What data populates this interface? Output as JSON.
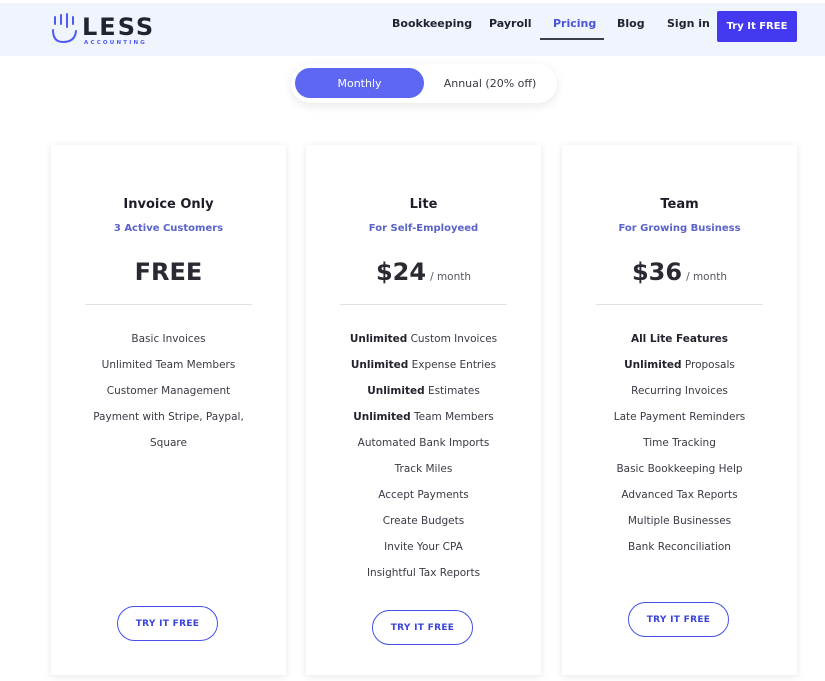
{
  "brand": {
    "name": "LESS",
    "sub": "ACCOUNTING",
    "accent": "#4438f0"
  },
  "nav": {
    "items": [
      "Bookkeeping",
      "Payroll",
      "Pricing",
      "Blog",
      "Sign in"
    ],
    "active": "Pricing",
    "cta": "Try It FREE"
  },
  "billing_toggle": {
    "monthly": "Monthly",
    "annual": "Annual (20% off)",
    "selected": "Monthly"
  },
  "plans": [
    {
      "name": "Invoice Only",
      "subtitle": "3 Active Customers",
      "price": "FREE",
      "period": "",
      "features": [
        {
          "strong": "",
          "text": "Basic Invoices"
        },
        {
          "strong": "",
          "text": "Unlimited Team Members"
        },
        {
          "strong": "",
          "text": "Customer Management"
        },
        {
          "strong": "",
          "text": "Payment with Stripe, Paypal,"
        },
        {
          "strong": "",
          "text": "Square"
        }
      ],
      "cta": "TRY IT FREE"
    },
    {
      "name": "Lite",
      "subtitle": "For Self-Employeed",
      "price": "$24",
      "period": "/ month",
      "features": [
        {
          "strong": "Unlimited",
          "text": " Custom Invoices"
        },
        {
          "strong": "Unlimited",
          "text": " Expense Entries"
        },
        {
          "strong": "Unlimited",
          "text": " Estimates"
        },
        {
          "strong": "Unlimited",
          "text": " Team Members"
        },
        {
          "strong": "",
          "text": "Automated Bank Imports"
        },
        {
          "strong": "",
          "text": "Track Miles"
        },
        {
          "strong": "",
          "text": "Accept Payments"
        },
        {
          "strong": "",
          "text": "Create Budgets"
        },
        {
          "strong": "",
          "text": "Invite Your CPA"
        },
        {
          "strong": "",
          "text": "Insightful Tax Reports"
        }
      ],
      "cta": "TRY IT FREE"
    },
    {
      "name": "Team",
      "subtitle": "For Growing Business",
      "price": "$36",
      "period": "/ month",
      "features": [
        {
          "strong": "All Lite Features",
          "text": ""
        },
        {
          "strong": "Unlimited",
          "text": " Proposals"
        },
        {
          "strong": "",
          "text": "Recurring Invoices"
        },
        {
          "strong": "",
          "text": "Late Payment Reminders"
        },
        {
          "strong": "",
          "text": "Time Tracking"
        },
        {
          "strong": "",
          "text": "Basic Bookkeeping Help"
        },
        {
          "strong": "",
          "text": "Advanced Tax Reports"
        },
        {
          "strong": "",
          "text": "Multiple Businesses"
        },
        {
          "strong": "",
          "text": "Bank Reconciliation"
        }
      ],
      "cta": "TRY IT FREE"
    }
  ]
}
